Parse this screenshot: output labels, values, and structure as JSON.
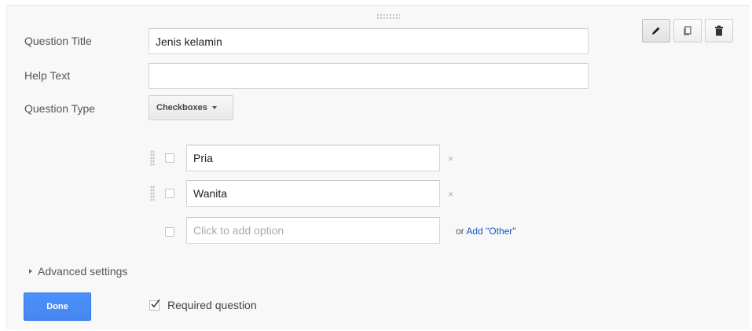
{
  "form": {
    "question_title_label": "Question Title",
    "question_title_value": "Jenis kelamin",
    "help_text_label": "Help Text",
    "help_text_value": "",
    "question_type_label": "Question Type",
    "question_type_value": "Checkboxes"
  },
  "toolbar": {
    "icons": [
      "pencil-icon",
      "duplicate-icon",
      "trash-icon"
    ]
  },
  "options": [
    {
      "value": "Pria",
      "remove": "×"
    },
    {
      "value": "Wanita",
      "remove": "×"
    }
  ],
  "add_option": {
    "placeholder": "Click to add option",
    "or_text": "or",
    "add_other_label": "Add \"Other\""
  },
  "advanced": {
    "label": "Advanced settings"
  },
  "footer": {
    "done_label": "Done",
    "required_label": "Required question",
    "required_checked": true
  },
  "colors": {
    "accent": "#4d90fe",
    "link": "#1155cc",
    "card_bg": "#f8f8f8"
  }
}
